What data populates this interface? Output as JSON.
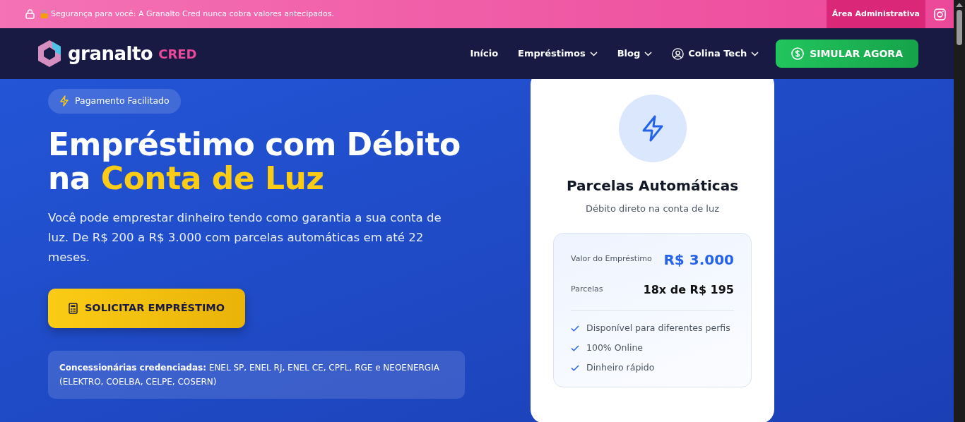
{
  "top_bar": {
    "notice": "Segurança para você: A Granalto Cred nunca cobra valores antecipados.",
    "admin_link": "Área Administrativa"
  },
  "navbar": {
    "brand": "granalto",
    "brand_suffix": "CRED",
    "items": [
      {
        "label": "Início",
        "dropdown": false
      },
      {
        "label": "Empréstimos",
        "dropdown": true
      },
      {
        "label": "Blog",
        "dropdown": true
      },
      {
        "label": "Colina Tech",
        "dropdown": true,
        "kind": "user"
      }
    ],
    "cta": "SIMULAR AGORA"
  },
  "hero": {
    "badge": "Pagamento Facilitado",
    "title_line1": "Empréstimo com Débito",
    "title_prefix": "na",
    "title_highlight": "Conta de Luz",
    "description": "Você pode emprestar dinheiro tendo como garantia a sua conta de luz. De R$ 200 a R$ 3.000 com parcelas automáticas em até 22 meses.",
    "button": "SOLICITAR EMPRÉSTIMO",
    "note": "**Concessionárias credenciadas:** ENEL SP, ENEL RJ, ENEL CE, CPFL, RGE e NEOENERGIA (ELEKTRO, COELBA, CELPE, COSERN)"
  },
  "card": {
    "title": "Parcelas Automáticas",
    "subtitle": "Débito direto na conta de luz",
    "rows": [
      {
        "label": "Valor do Empréstimo",
        "value": "R$ 3.000",
        "kind": "highlight"
      },
      {
        "label": "Parcelas",
        "value": "18x de R$ 195",
        "kind": "plain"
      }
    ],
    "features": [
      "Disponível para diferentes perfis",
      "100% Online",
      "Dinheiro rápido"
    ]
  }
}
